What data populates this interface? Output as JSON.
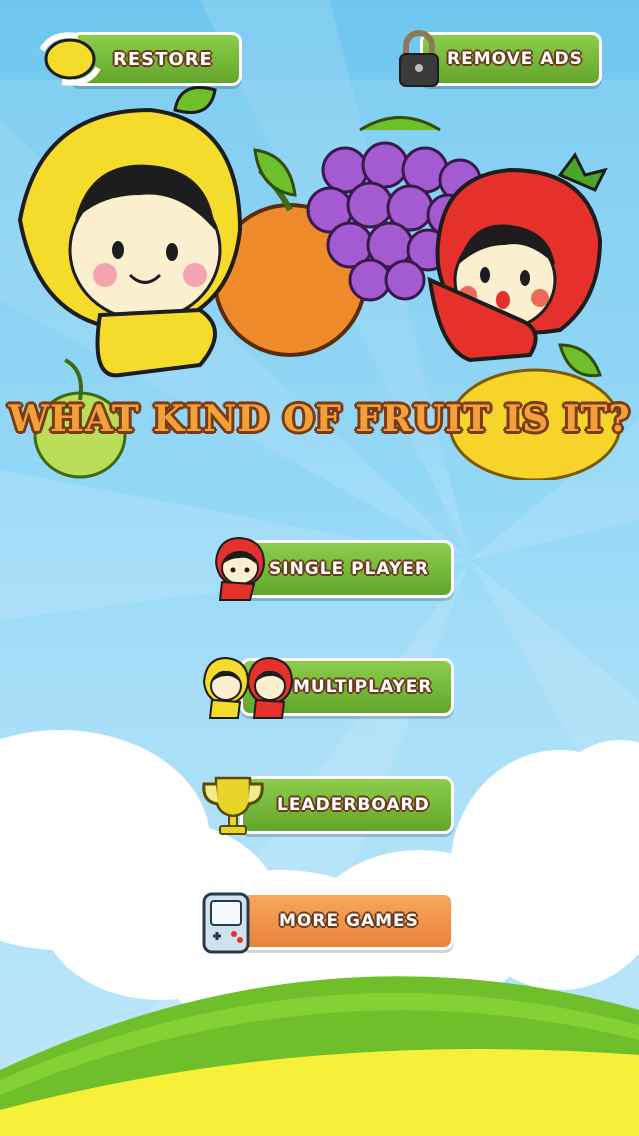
{
  "game": {
    "title": "WHAT KIND OF FRUIT IS IT?"
  },
  "top_bar": {
    "restore_label": "RESTORE",
    "remove_ads_label": "REMOVE ADS"
  },
  "menu": {
    "single_player_label": "SINGLE PLAYER",
    "multiplayer_label": "MULTIPLAYER",
    "leaderboard_label": "LEADERBOARD",
    "more_games_label": "MORE GAMES"
  },
  "colors": {
    "sky": "#8fd6f6",
    "button_green": "#7bbf3e",
    "button_orange": "#f09848",
    "text_outline": "#6b3a1a",
    "title_fill": "#f4a03a",
    "grass": "#6fbf2a",
    "ground_yellow": "#f7f03a"
  },
  "icons": {
    "restore": "restore-arrows-lemon-icon",
    "remove_ads": "padlock-icon",
    "single_player": "strawberry-girl-icon",
    "multiplayer": "lemon-and-strawberry-kids-icon",
    "leaderboard": "trophy-icon",
    "more_games": "handheld-console-icon"
  }
}
